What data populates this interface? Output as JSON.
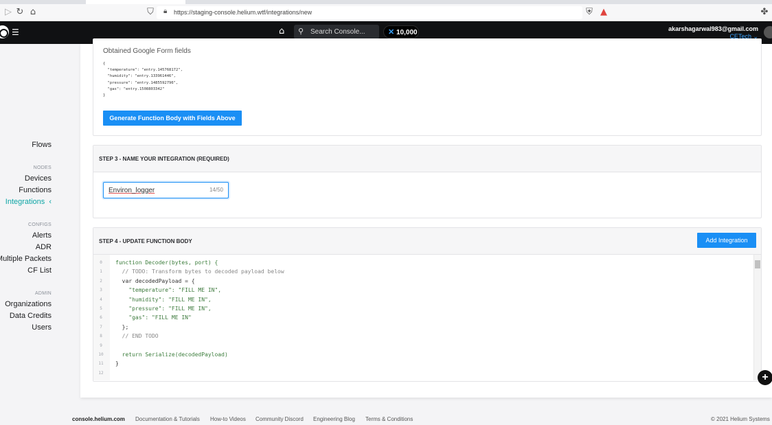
{
  "browser": {
    "url": "https://staging-console.helium.wtf/integrations/new"
  },
  "appbar": {
    "search_placeholder": "Search Console...",
    "dc_balance": "10,000",
    "user_email": "akarshagarwal983@gmail.com",
    "org_name": "CETech"
  },
  "sidebar": {
    "flows": "Flows",
    "nodes_section": "NODES",
    "devices": "Devices",
    "functions": "Functions",
    "integrations": "Integrations",
    "integrations_chevron": "‹",
    "configs_section": "CONFIGS",
    "alerts": "Alerts",
    "adr": "ADR",
    "multiple_packets": "Multiple Packets",
    "cf_list": "CF List",
    "admin_section": "ADMIN",
    "organizations": "Organizations",
    "data_credits": "Data Credits",
    "users": "Users"
  },
  "step2": {
    "fields_label": "Obtained Google Form fields",
    "fields_json": "{\n  \"temperature\": \"entry.145768172\",\n  \"humidity\": \"entry.133961446\",\n  \"pressure\": \"entry.1485592796\",\n  \"gas\": \"entry.1508803342\"\n}",
    "generate_button": "Generate Function Body with Fields Above"
  },
  "step3": {
    "title": "STEP 3 - NAME YOUR INTEGRATION (REQUIRED)",
    "name_value": "Environ_logger",
    "char_count": "14/50"
  },
  "step4": {
    "title": "STEP 4 - UPDATE FUNCTION BODY",
    "add_button": "Add Integration",
    "code_lines": [
      {
        "n": "0",
        "t": "function Decoder(bytes, port) {",
        "c": "kw"
      },
      {
        "n": "1",
        "t": "  // TODO: Transform bytes to decoded payload below",
        "c": "cm"
      },
      {
        "n": "2",
        "t": "  var decodedPayload = {",
        "c": "var"
      },
      {
        "n": "3",
        "t": "    \"temperature\": \"FILL ME IN\",",
        "c": "str"
      },
      {
        "n": "4",
        "t": "    \"humidity\": \"FILL ME IN\",",
        "c": "str"
      },
      {
        "n": "5",
        "t": "    \"pressure\": \"FILL ME IN\",",
        "c": "str"
      },
      {
        "n": "6",
        "t": "    \"gas\": \"FILL ME IN\"",
        "c": "str"
      },
      {
        "n": "7",
        "t": "  };",
        "c": "plain"
      },
      {
        "n": "8",
        "t": "  // END TODO",
        "c": "cm"
      },
      {
        "n": "9",
        "t": "",
        "c": "plain"
      },
      {
        "n": "10",
        "t": "  return Serialize(decodedPayload)",
        "c": "ret"
      },
      {
        "n": "11",
        "t": "}",
        "c": "plain"
      },
      {
        "n": "12",
        "t": "",
        "c": "plain"
      }
    ]
  },
  "footer": {
    "brand": "console.helium.com",
    "docs": "Documentation & Tutorials",
    "videos": "How-to Videos",
    "discord": "Community Discord",
    "blog": "Engineering Blog",
    "terms": "Terms & Conditions",
    "copyright": "© 2021 Helium Systems"
  },
  "colors": {
    "accent_blue": "#1a8ff5",
    "active_teal": "#0da5a5",
    "appbar_bg": "#101113",
    "code_keyword": "#3b7d3b",
    "code_string": "#3d7a3d",
    "code_comment": "#888888"
  },
  "icons": [
    "back-icon",
    "reload-icon",
    "home-icon",
    "bookmark-icon",
    "lock-icon",
    "brave-shield-icon",
    "brave-rewards-icon",
    "extensions-icon",
    "helium-logo-icon",
    "menu-icon",
    "search-icon",
    "data-credits-icon",
    "avatar-icon",
    "plus-icon"
  ]
}
